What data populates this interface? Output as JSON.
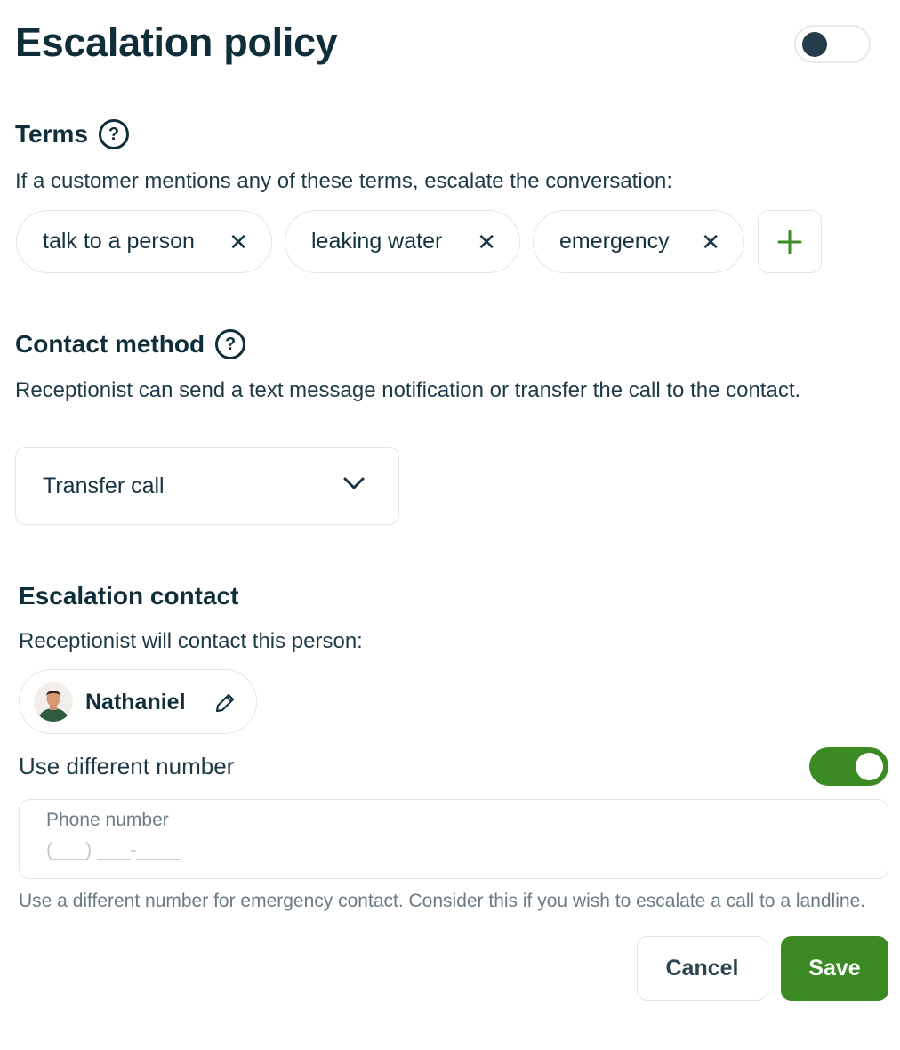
{
  "header": {
    "title": "Escalation policy",
    "enabled": false
  },
  "terms": {
    "heading": "Terms",
    "help_icon": "?",
    "description": "If a customer mentions any of these terms, escalate the conversation:",
    "items": [
      {
        "label": "talk to a person",
        "remove_icon": "✕"
      },
      {
        "label": "leaking water",
        "remove_icon": "✕"
      },
      {
        "label": "emergency",
        "remove_icon": "✕"
      }
    ]
  },
  "contact_method": {
    "heading": "Contact method",
    "help_icon": "?",
    "description": "Receptionist can send a text message notification or transfer the call to the contact.",
    "selected": "Transfer call"
  },
  "escalation_contact": {
    "heading": "Escalation contact",
    "description": "Receptionist will contact this person:",
    "contact_name": "Nathaniel",
    "use_different_number_label": "Use different number",
    "use_different_number_enabled": true,
    "phone_label": "Phone number",
    "phone_placeholder": "(___) ___-____",
    "help_text": "Use a different number for emergency contact. Consider this if you wish to escalate a call to a landline."
  },
  "actions": {
    "cancel": "Cancel",
    "save": "Save"
  },
  "colors": {
    "accent": "#3b8a24",
    "text": "#102d3a",
    "border": "#e2e6e8"
  }
}
